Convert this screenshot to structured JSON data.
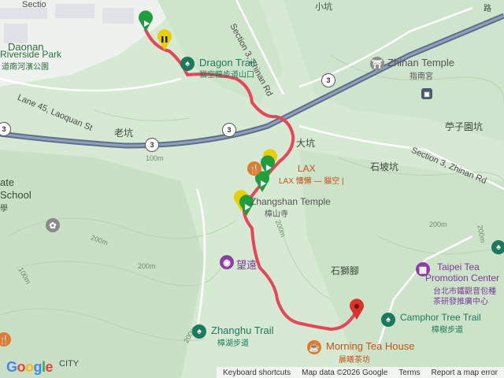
{
  "map": {
    "places": {
      "daonan_park_en": "Daonan",
      "daonan_park_en2": "Riverside Park",
      "daonan_park_cn": "道南河濱公園",
      "section3_top": "Section 3, Zhinan Rd",
      "section3_right": "Section 3, Zhinan Rd",
      "lane45": "Lane 45, Laoquan St",
      "laokeng": "老坑",
      "dakeng": "大坑",
      "xiaokeng": "小坑",
      "shipokeng": "石坡坑",
      "tingziyuankeng": "苧子園坑",
      "shishijiao": "石獅腳",
      "ate": "ate",
      "school": "School",
      "xue": "學",
      "cheng_top": "路",
      "section_left": "Sectio",
      "city_bottom": "CITY"
    },
    "pois": {
      "dragon_trail": "Dragon Trail",
      "dragon_trail_cn": "貓空龍步道山口",
      "zhinan_temple": "Zhinan Temple",
      "zhinan_temple_cn": "指南宮",
      "lax": "LAX",
      "lax_cn": "LAX 慵懶 — 貓空 |",
      "zhangshan_temple": "Zhangshan Temple",
      "zhangshan_temple_cn": "樟山寺",
      "wangyuan": "望遠",
      "zhanghu_trail": "Zhanghu Trail",
      "zhanghu_trail_cn": "樟湖步道",
      "morning_tea": "Morning Tea House",
      "morning_tea_cn": "晨曦茶坊",
      "taipei_tea_1": "Taipei Tea",
      "taipei_tea_2": "Promotion Center",
      "taipei_tea_cn1": "台北市鐵觀音包種",
      "taipei_tea_cn2": "茶研發推廣中心",
      "camphor_tree": "Camphor Tree Trail",
      "camphor_tree_cn": "樟樹步道"
    },
    "contours": [
      "200m",
      "100m",
      "200m",
      "200m",
      "100m",
      "200m",
      "200m",
      "200m"
    ],
    "route_badges": [
      "3",
      "3",
      "3",
      "3"
    ],
    "colors": {
      "route": "#e8455a",
      "terrain": "#d9ebd6",
      "highway": "#5f6f8a",
      "start_marker": "#1e9e3e",
      "pause_marker": "#e8d000",
      "end_marker": "#d9342b"
    }
  },
  "footer": {
    "google": "Google",
    "shortcuts": "Keyboard shortcuts",
    "map_data": "Map data ©2026 Google",
    "terms": "Terms",
    "report": "Report a map error"
  }
}
